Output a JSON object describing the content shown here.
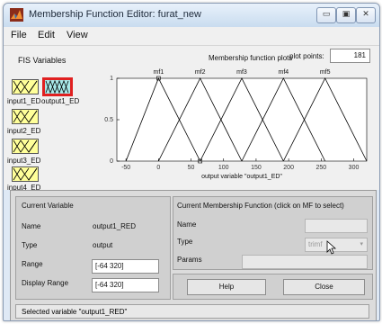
{
  "window": {
    "title": "Membership Function Editor: furat_new",
    "min_label": "▭",
    "max_label": "▣",
    "close_label": "✕"
  },
  "menu": [
    "File",
    "Edit",
    "View"
  ],
  "fis": {
    "heading": "FIS Variables",
    "inputs": [
      "input1_ED",
      "input2_ED",
      "input3_ED",
      "input4_ED"
    ],
    "output": "output1_ED"
  },
  "plot": {
    "heading": "Membership function plots",
    "points_label": "plot points:",
    "points_value": "181",
    "xlabel": "output variable \"output1_ED\""
  },
  "chart_data": {
    "type": "line",
    "title": "Membership function plots",
    "xlabel": "output variable \"output1_ED\"",
    "ylabel": "",
    "xlim": [
      -64,
      320
    ],
    "ylim": [
      0,
      1
    ],
    "x_ticks": [
      -50,
      0,
      50,
      100,
      150,
      200,
      250,
      300
    ],
    "y_ticks": [
      0,
      0.5,
      1
    ],
    "series": [
      {
        "name": "mf1",
        "points": [
          [
            -50,
            0
          ],
          [
            0,
            1
          ],
          [
            64,
            0
          ]
        ]
      },
      {
        "name": "mf2",
        "points": [
          [
            0,
            0
          ],
          [
            64,
            1
          ],
          [
            128,
            0
          ]
        ]
      },
      {
        "name": "mf3",
        "points": [
          [
            64,
            0
          ],
          [
            128,
            1
          ],
          [
            192,
            0
          ]
        ]
      },
      {
        "name": "mf4",
        "points": [
          [
            128,
            0
          ],
          [
            192,
            1
          ],
          [
            256,
            0
          ]
        ]
      },
      {
        "name": "mf5",
        "points": [
          [
            192,
            0
          ],
          [
            256,
            1
          ],
          [
            320,
            0
          ]
        ]
      }
    ]
  },
  "current_variable": {
    "heading": "Current Variable",
    "name_label": "Name",
    "name_value": "output1_RED",
    "type_label": "Type",
    "type_value": "output",
    "range_label": "Range",
    "range_value": "[-64 320]",
    "display_label": "Display Range",
    "display_value": "[-64 320]"
  },
  "current_mf": {
    "heading": "Current Membership Function (click on MF to select)",
    "name_label": "Name",
    "name_value": "",
    "type_label": "Type",
    "type_value": "trimf",
    "params_label": "Params",
    "params_value": ""
  },
  "buttons": {
    "help": "Help",
    "close": "Close"
  },
  "status": "Selected variable \"output1_RED\"",
  "colors": {
    "title_bg": "#c9dcef",
    "input_box": "#ffff99",
    "output_box": "#a8e8e8",
    "selection": "#e02020"
  }
}
